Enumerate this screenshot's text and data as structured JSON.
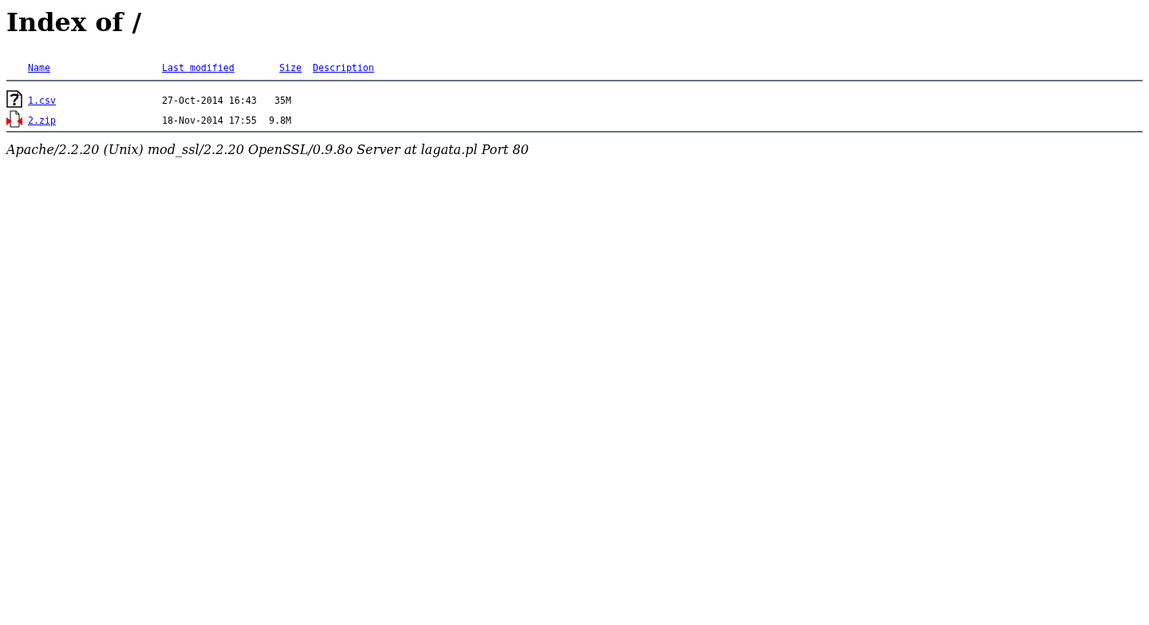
{
  "title": "Index of /",
  "columns": [
    "Name",
    "Last modified",
    "Size",
    "Description"
  ],
  "rows": [
    {
      "kind": "unknown",
      "name": "1.csv",
      "modified": "27-Oct-2014 16:43",
      "size": "35M"
    },
    {
      "kind": "compressed",
      "name": "2.zip",
      "modified": "18-Nov-2014 17:55",
      "size": "9.8M"
    }
  ],
  "footer": "Apache/2.2.20 (Unix) mod_ssl/2.2.20 OpenSSL/0.9.8o Server at lagata.pl Port 80"
}
